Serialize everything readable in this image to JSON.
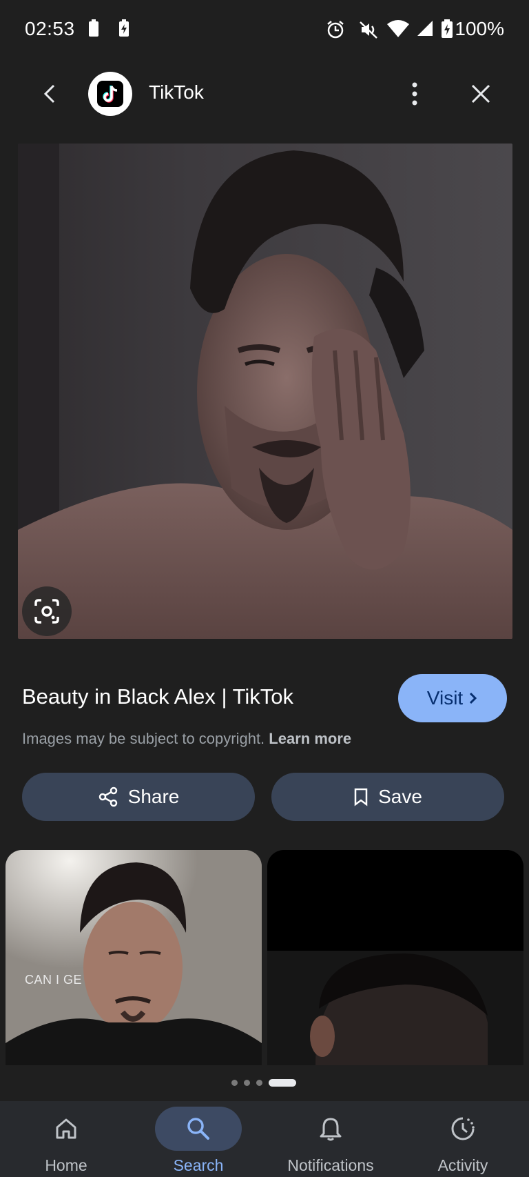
{
  "status_bar": {
    "time": "02:53",
    "battery": "100%",
    "icons": [
      "sim-icon",
      "battery-saver-icon",
      "alarm-icon",
      "mute-icon",
      "wifi-icon",
      "signal-icon",
      "battery-charging-icon"
    ]
  },
  "header": {
    "source_name": "TikTok",
    "back_icon": "back-arrow-icon",
    "more_icon": "more-vert-icon",
    "close_icon": "close-icon",
    "source_logo_icon": "tiktok-logo-icon"
  },
  "result": {
    "title": "Beauty in Black Alex | TikTok",
    "visit_label": "Visit",
    "copyright_text": "Images may be subject to copyright.",
    "learn_more": "Learn more",
    "share_label": "Share",
    "save_label": "Save",
    "lens_icon": "lens-search-icon"
  },
  "related": {
    "thumb1_caption": "CAN I GE"
  },
  "pager": {
    "count": 4,
    "active_index": 3
  },
  "bottom_nav": {
    "items": [
      {
        "label": "Home",
        "icon": "home-icon"
      },
      {
        "label": "Search",
        "icon": "search-icon"
      },
      {
        "label": "Notifications",
        "icon": "bell-icon"
      },
      {
        "label": "Activity",
        "icon": "activity-icon"
      }
    ],
    "active": "Search"
  },
  "colors": {
    "background": "#1f1f1f",
    "accent": "#8ab4f8",
    "pill_button": "#394457",
    "nav_bar": "#282a2e"
  }
}
